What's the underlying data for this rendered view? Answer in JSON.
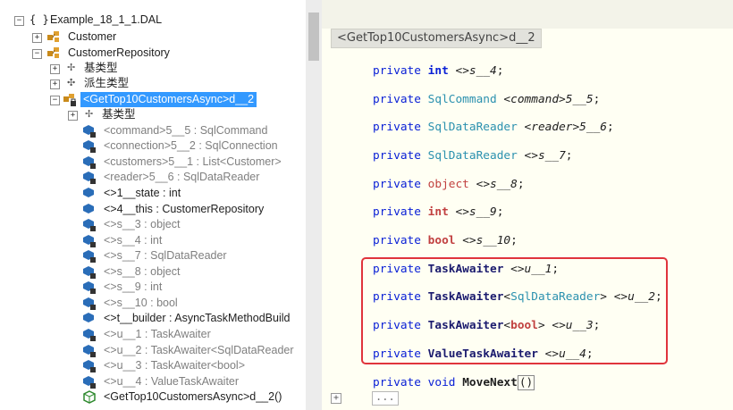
{
  "tree": {
    "namespace": {
      "brace": "{ }",
      "label": "Example_18_1_1.DAL"
    },
    "customer": "Customer",
    "repository": "CustomerRepository",
    "base_types": "基类型",
    "derived_types": "派生类型",
    "selected_class": "<GetTop10CustomersAsync>d__2",
    "nested_base_types": "基类型",
    "members": [
      {
        "text": "<command>5__5 : SqlCommand",
        "style": "gray"
      },
      {
        "text": "<connection>5__2 : SqlConnection",
        "style": "gray"
      },
      {
        "text": "<customers>5__1 : List<Customer>",
        "style": "gray"
      },
      {
        "text": "<reader>5__6 : SqlDataReader",
        "style": "gray"
      },
      {
        "text": "<>1__state : int",
        "style": "dark"
      },
      {
        "text": "<>4__this : CustomerRepository",
        "style": "dark"
      },
      {
        "text": "<>s__3 : object",
        "style": "gray"
      },
      {
        "text": "<>s__4 : int",
        "style": "gray"
      },
      {
        "text": "<>s__7 : SqlDataReader",
        "style": "gray"
      },
      {
        "text": "<>s__8 : object",
        "style": "gray"
      },
      {
        "text": "<>s__9 : int",
        "style": "gray"
      },
      {
        "text": "<>s__10 : bool",
        "style": "gray"
      },
      {
        "text": "<>t__builder : AsyncTaskMethodBuild",
        "style": "dark"
      },
      {
        "text": "<>u__1 : TaskAwaiter",
        "style": "gray"
      },
      {
        "text": "<>u__2 : TaskAwaiter<SqlDataReader",
        "style": "gray"
      },
      {
        "text": "<>u__3 : TaskAwaiter<bool>",
        "style": "gray"
      },
      {
        "text": "<>u__4 : ValueTaskAwaiter",
        "style": "gray"
      },
      {
        "text": "<GetTop10CustomersAsync>d__2()",
        "style": "dark"
      }
    ]
  },
  "editor": {
    "tab_label": "<GetTop10CustomersAsync>d__2",
    "kw_private": "private",
    "kw_void": "void",
    "lines": [
      {
        "type": "int",
        "type_style": "kw",
        "name": "<>s__4",
        "suffix": ";"
      },
      {
        "type": "SqlCommand",
        "type_style": "ty",
        "name": "<command>5__5",
        "suffix": ";"
      },
      {
        "type": "SqlDataReader",
        "type_style": "ty",
        "name": "<reader>5__6",
        "suffix": ";"
      },
      {
        "type": "SqlDataReader",
        "type_style": "ty",
        "name": "<>s__7",
        "suffix": ";"
      },
      {
        "type": "object",
        "type_style": "kw",
        "name": "<>s__8",
        "suffix": ";"
      },
      {
        "type": "int",
        "type_style": "kw",
        "name": "<>s__9",
        "suffix": ";"
      },
      {
        "type": "bool",
        "type_style": "kw",
        "name": "<>s__10",
        "suffix": ";"
      }
    ],
    "awaiters": {
      "u1": {
        "type": "TaskAwaiter",
        "name": "<>u__1"
      },
      "u2": {
        "type": "TaskAwaiter",
        "arg": "SqlDataReader",
        "name": "<>u__2"
      },
      "u3": {
        "type": "TaskAwaiter",
        "arg": "bool",
        "name": "<>u__3"
      },
      "u4": {
        "type": "ValueTaskAwaiter",
        "name": "<>u__4"
      }
    },
    "method": {
      "name": "MoveNext",
      "parens": "()"
    },
    "fold_symbol": "+",
    "collapsed": "..."
  },
  "colors": {
    "highlight_border": "#e0343c",
    "selection": "#3399ff",
    "keyword": "#0a20d6",
    "type": "#2b91af"
  }
}
